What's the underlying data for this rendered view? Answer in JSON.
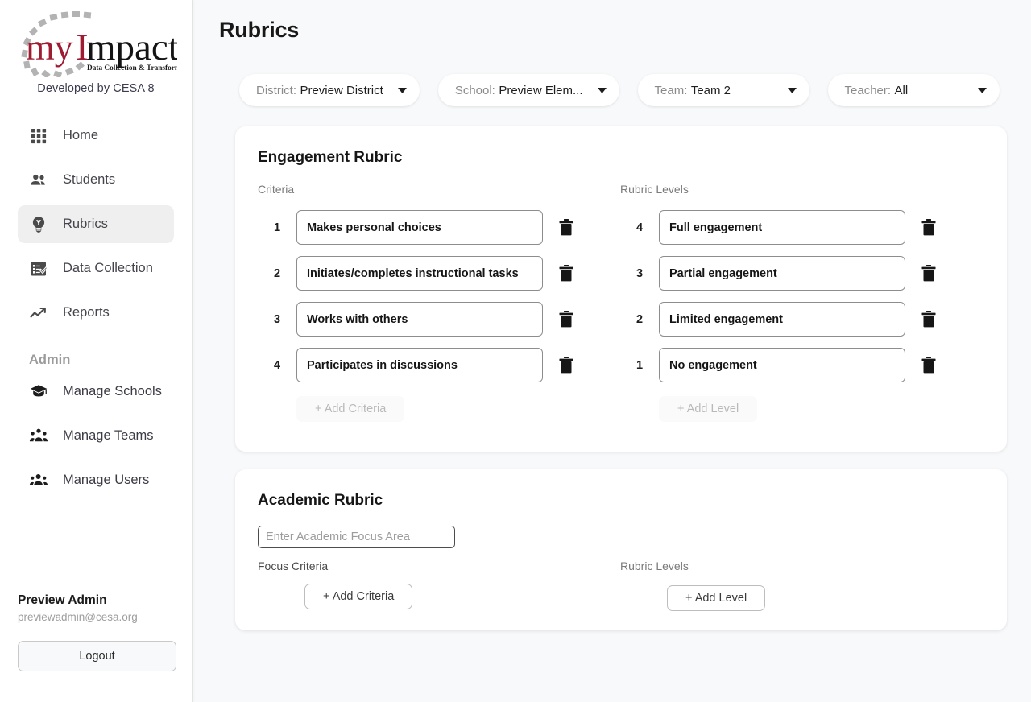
{
  "sidebar": {
    "logo": {
      "word_my": "my",
      "word_impact": "Impact",
      "tagline": "Data Collection & Transformation Tool",
      "developed_by": "Developed by CESA 8",
      "accent_color": "#9e1b32",
      "dark_color": "#1a1a1a",
      "ring_color": "#b0b0b0"
    },
    "nav": [
      {
        "label": "Home",
        "icon": "grid-apps-icon",
        "active": false
      },
      {
        "label": "Students",
        "icon": "people-icon",
        "active": false
      },
      {
        "label": "Rubrics",
        "icon": "lightbulb-icon",
        "active": true
      },
      {
        "label": "Data Collection",
        "icon": "checklist-icon",
        "active": false
      },
      {
        "label": "Reports",
        "icon": "trending-up-icon",
        "active": false
      }
    ],
    "admin_heading": "Admin",
    "admin_nav": [
      {
        "label": "Manage Schools",
        "icon": "graduation-cap-icon"
      },
      {
        "label": "Manage Teams",
        "icon": "group-icon"
      },
      {
        "label": "Manage Users",
        "icon": "users-icon"
      }
    ],
    "user": {
      "name": "Preview Admin",
      "email": "previewadmin@cesa.org",
      "logout_label": "Logout"
    }
  },
  "header": {
    "title": "Rubrics"
  },
  "filters": [
    {
      "label": "District:",
      "value": "Preview District",
      "name": "district"
    },
    {
      "label": "School:",
      "value": "Preview Elem...",
      "name": "school"
    },
    {
      "label": "Team:",
      "value": "Team 2",
      "name": "team"
    },
    {
      "label": "Teacher:",
      "value": "All",
      "name": "teacher"
    }
  ],
  "engagement_rubric": {
    "title": "Engagement Rubric",
    "criteria_heading": "Criteria",
    "levels_heading": "Rubric Levels",
    "criteria": [
      {
        "num": "1",
        "text": "Makes personal choices"
      },
      {
        "num": "2",
        "text": "Initiates/completes instructional tasks"
      },
      {
        "num": "3",
        "text": "Works with others"
      },
      {
        "num": "4",
        "text": "Participates in discussions"
      }
    ],
    "levels": [
      {
        "num": "4",
        "text": "Full engagement"
      },
      {
        "num": "3",
        "text": "Partial engagement"
      },
      {
        "num": "2",
        "text": "Limited engagement"
      },
      {
        "num": "1",
        "text": "No engagement"
      }
    ],
    "add_criteria_label": "+  Add Criteria",
    "add_level_label": "+  Add Level",
    "add_disabled": true
  },
  "academic_rubric": {
    "title": "Academic Rubric",
    "focus_placeholder": "Enter Academic Focus Area",
    "focus_value": "",
    "criteria_heading": "Focus Criteria",
    "levels_heading": "Rubric Levels",
    "add_criteria_label": "+  Add Criteria",
    "add_level_label": "+  Add Level"
  }
}
